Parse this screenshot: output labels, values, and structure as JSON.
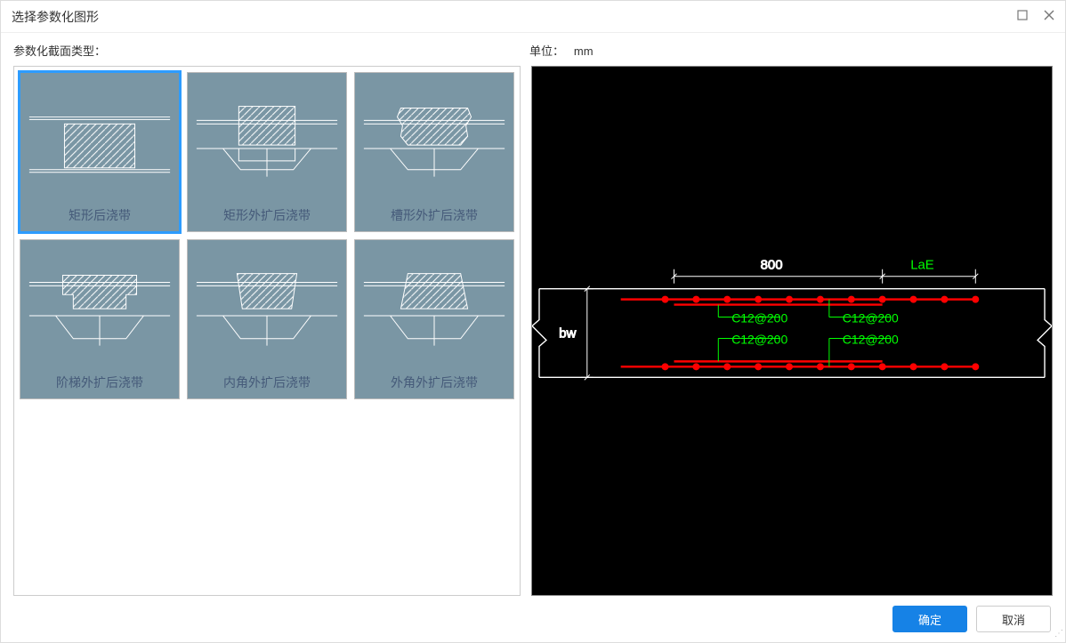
{
  "window": {
    "title": "选择参数化图形"
  },
  "labels": {
    "section_type": "参数化截面类型：",
    "unit_label": "单位：",
    "unit_value": "mm"
  },
  "thumbs": [
    {
      "label": "矩形后浇带",
      "selected": true
    },
    {
      "label": "矩形外扩后浇带",
      "selected": false
    },
    {
      "label": "槽形外扩后浇带",
      "selected": false
    },
    {
      "label": "阶梯外扩后浇带",
      "selected": false
    },
    {
      "label": "内角外扩后浇带",
      "selected": false
    },
    {
      "label": "外角外扩后浇带",
      "selected": false
    }
  ],
  "preview": {
    "dim_top": "800",
    "lae": "LaE",
    "bw": "bw",
    "rebars": [
      "C12@200",
      "C12@200",
      "C12@200",
      "C12@200"
    ]
  },
  "buttons": {
    "ok": "确定",
    "cancel": "取消"
  }
}
